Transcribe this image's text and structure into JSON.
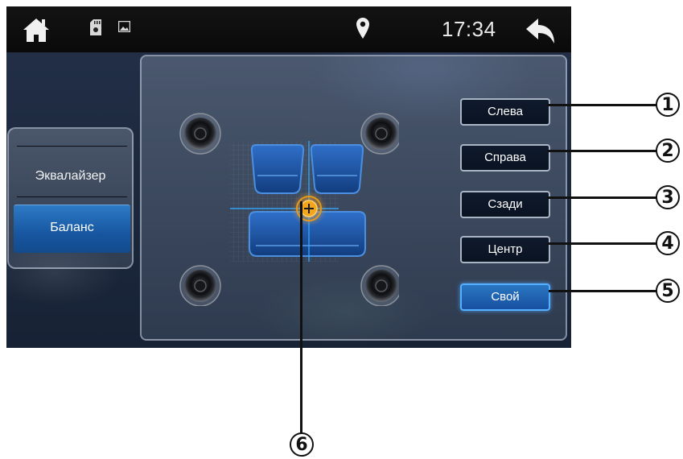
{
  "status_bar": {
    "time": "17:34",
    "icons": [
      "home-icon",
      "sd-card-icon",
      "gallery-icon",
      "location-pin-icon",
      "back-arrow-icon"
    ]
  },
  "side_menu": {
    "items": [
      {
        "label": "Эквалайзер",
        "active": false
      },
      {
        "label": "Баланс",
        "active": true
      }
    ]
  },
  "balance_panel": {
    "speakers": [
      "front-left",
      "front-right",
      "rear-left",
      "rear-right"
    ],
    "presets": [
      {
        "label": "Слева",
        "active": false
      },
      {
        "label": "Справа",
        "active": false
      },
      {
        "label": "Сзади",
        "active": false
      },
      {
        "label": "Центр",
        "active": false
      },
      {
        "label": "Свой",
        "active": true
      }
    ],
    "balance_marker": "crosshair-plus-icon"
  },
  "annotations": [
    "1",
    "2",
    "3",
    "4",
    "5",
    "6"
  ],
  "colors": {
    "accent_blue": "#1f63b0",
    "active_border": "#55b0ff",
    "marker_orange": "#f3a51b",
    "seat_blue": "#1e5fb5"
  }
}
